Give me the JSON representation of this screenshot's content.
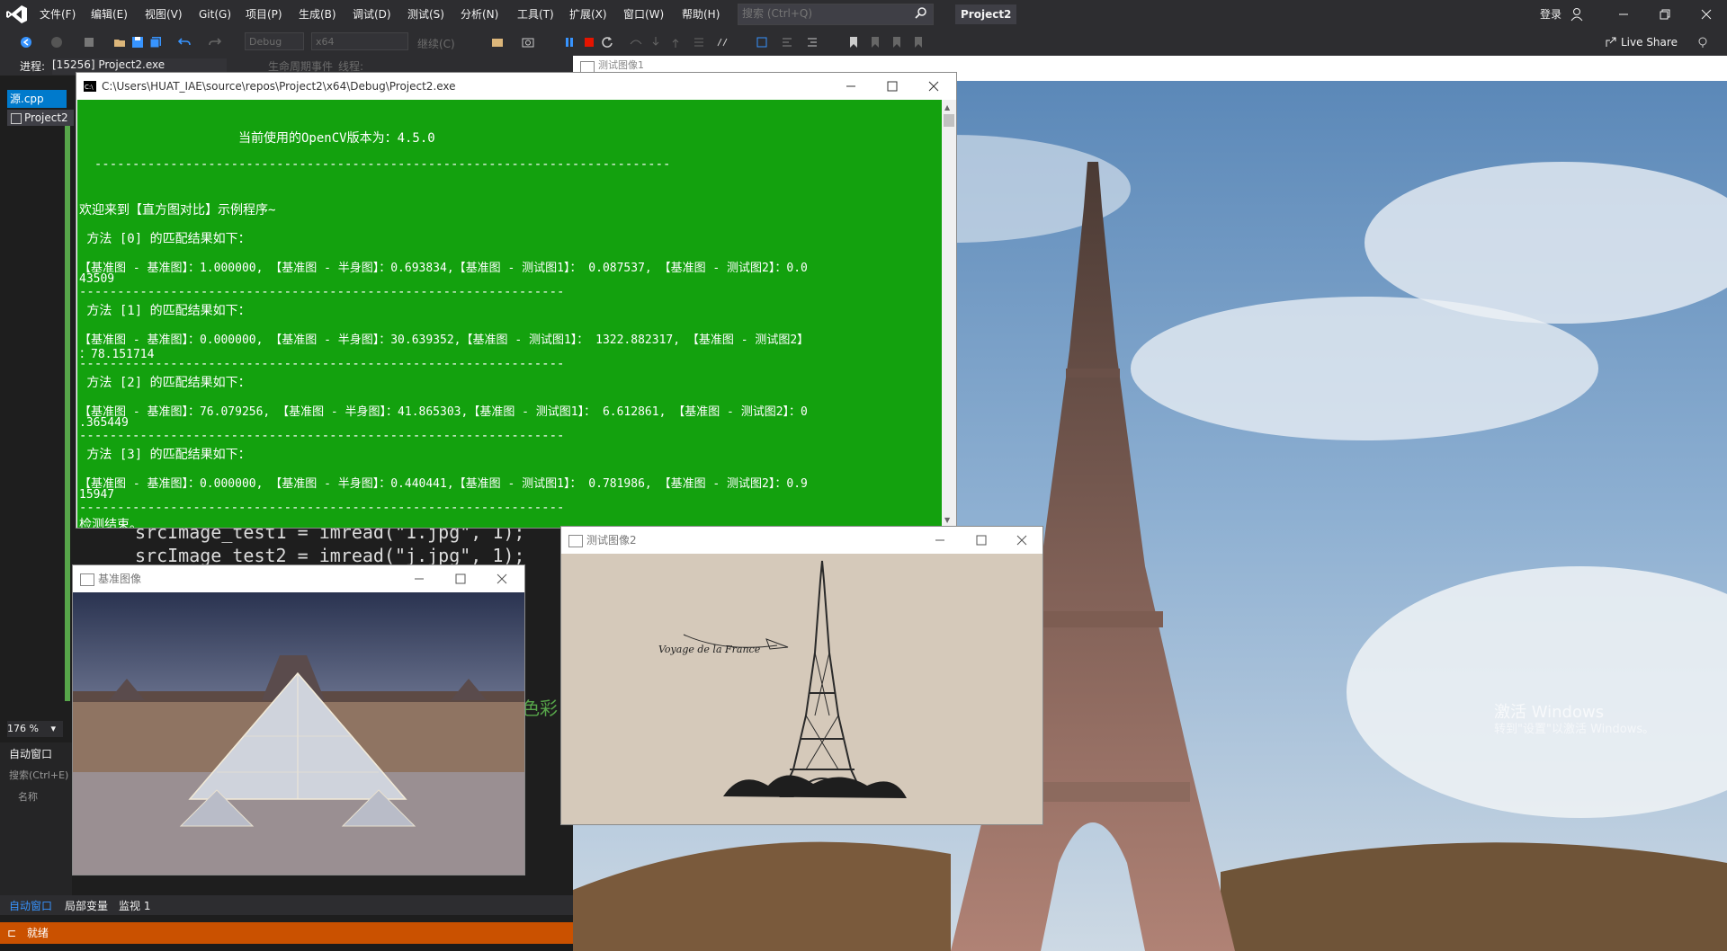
{
  "menu": {
    "items": [
      "文件(F)",
      "编辑(E)",
      "视图(V)",
      "Git(G)",
      "项目(P)",
      "生成(B)",
      "调试(D)",
      "测试(S)",
      "分析(N)",
      "工具(T)",
      "扩展(X)",
      "窗口(W)",
      "帮助(H)"
    ],
    "search_placeholder": "搜索 (Ctrl+Q)",
    "project_title": "Project2",
    "login": "登录"
  },
  "toolbar": {
    "config": "Debug",
    "platform": "x64",
    "continue": "继续(C)",
    "liveshare": "Live Share"
  },
  "procbar": {
    "label": "进程:",
    "value": "[15256] Project2.exe",
    "lifecycle": "生命周期事件",
    "thread": "线程:"
  },
  "editor": {
    "doc_tab": "源.cpp",
    "project_tab": "Project2",
    "code_line1": "srcImage_test1 = imread(\"1.jpg\", 1);",
    "code_line2": "srcImage_test2 = imread(\"j.jpg\", 1);",
    "hint": "色彩",
    "zoom": "176 %"
  },
  "autos": {
    "title": "自动窗口",
    "search": "搜索(Ctrl+E)",
    "col_name": "名称"
  },
  "bottom_tabs": [
    "自动窗口",
    "局部变量",
    "监视 1"
  ],
  "status": "就绪",
  "bg_window": {
    "title": "测试图像1",
    "watermark_line1": "激活 Windows",
    "watermark_line2": "转到\"设置\"以激活 Windows。"
  },
  "console": {
    "title": "C:\\Users\\HUAT_IAE\\source\\repos\\Project2\\x64\\Debug\\Project2.exe",
    "lines": [
      "                     当前使用的OpenCV版本为：4.5.0",
      "  ----------------------------------------------------------------------------",
      "欢迎来到【直方图对比】示例程序~",
      " 方法 [0] 的匹配结果如下：",
      "【基准图 - 基准图】：1.000000, 【基准图 - 半身图】：0.693834,【基准图 - 测试图1】： 0.087537, 【基准图 - 测试图2】：0.0",
      "43509",
      "----------------------------------------------------------------",
      " 方法 [1] 的匹配结果如下：",
      "【基准图 - 基准图】：0.000000, 【基准图 - 半身图】：30.639352,【基准图 - 测试图1】： 1322.882317, 【基准图 - 测试图2】",
      "：78.151714",
      "----------------------------------------------------------------",
      " 方法 [2] 的匹配结果如下：",
      "【基准图 - 基准图】：76.079256, 【基准图 - 半身图】：41.865303,【基准图 - 测试图1】： 6.612861, 【基准图 - 测试图2】：0",
      ".365449",
      "----------------------------------------------------------------",
      " 方法 [3] 的匹配结果如下：",
      "【基准图 - 基准图】：0.000000, 【基准图 - 半身图】：0.440441,【基准图 - 测试图1】： 0.781986, 【基准图 - 测试图2】：0.9",
      "15947",
      "----------------------------------------------------------------",
      "检测结束。"
    ]
  },
  "base_window": {
    "title": "基准图像"
  },
  "test2_window": {
    "title": "测试图像2",
    "caption": "Voyage de la France"
  }
}
